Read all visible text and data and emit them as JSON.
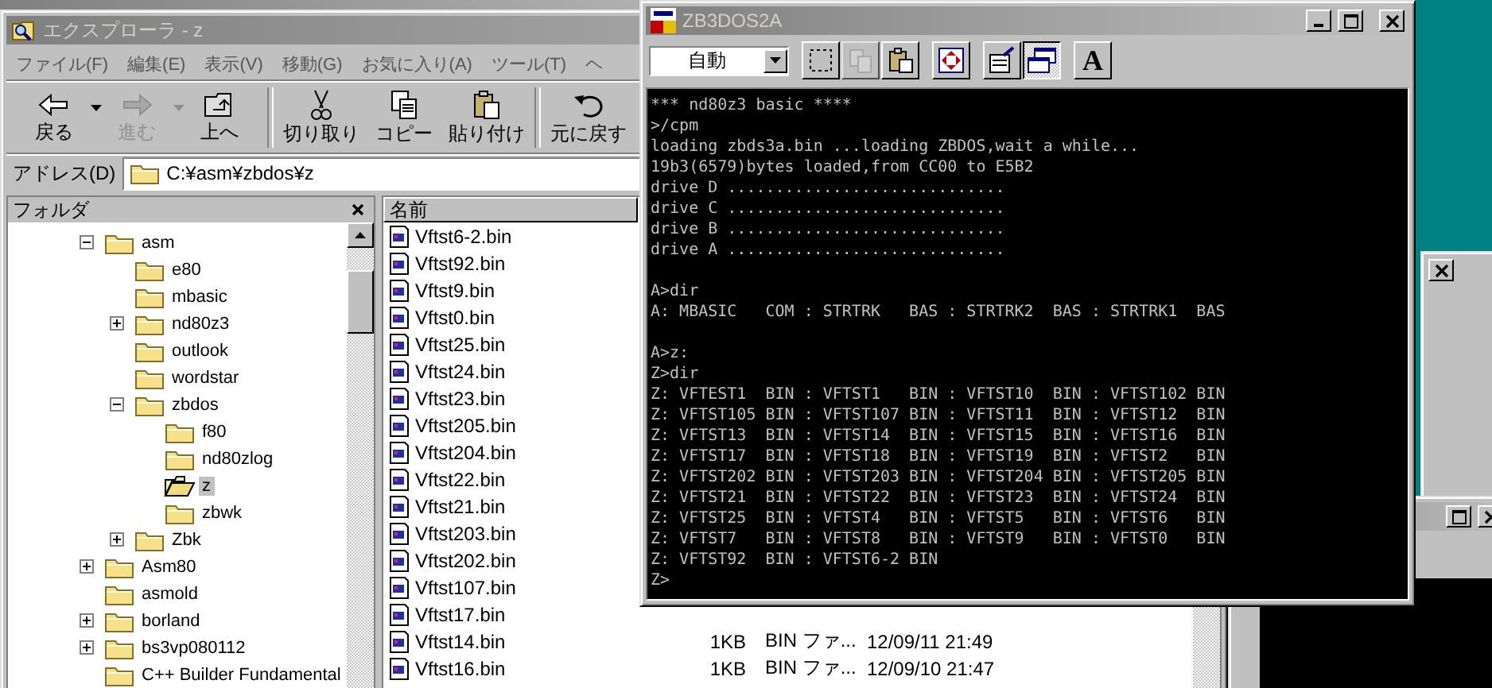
{
  "explorer": {
    "title": "エクスプローラ - z",
    "menu": [
      "ファイル(F)",
      "編集(E)",
      "表示(V)",
      "移動(G)",
      "お気に入り(A)",
      "ツール(T)",
      "ヘ"
    ],
    "toolbar": [
      [
        {
          "kind": "back",
          "label": "戻る",
          "disabled": false,
          "dropdown": true
        },
        {
          "kind": "forward",
          "label": "進む",
          "disabled": true,
          "dropdown": true
        },
        {
          "kind": "up",
          "label": "上へ",
          "disabled": false,
          "dropdown": false
        }
      ],
      [
        {
          "kind": "cut",
          "label": "切り取り",
          "disabled": false,
          "dropdown": false
        },
        {
          "kind": "copy",
          "label": "コピー",
          "disabled": false,
          "dropdown": false
        },
        {
          "kind": "paste",
          "label": "貼り付け",
          "disabled": false,
          "dropdown": false
        }
      ],
      [
        {
          "kind": "undo",
          "label": "元に戻す",
          "disabled": false,
          "dropdown": false
        }
      ]
    ],
    "address": {
      "label": "アドレス(D)",
      "value": "C:¥asm¥zbdos¥z"
    },
    "folders": {
      "title": "フォルダ",
      "items": [
        {
          "name": "asm",
          "expandable": true,
          "expanded": true,
          "selected": false,
          "children": [
            {
              "name": "e80",
              "expandable": false,
              "expanded": false,
              "selected": false
            },
            {
              "name": "mbasic",
              "expandable": false,
              "expanded": false,
              "selected": false
            },
            {
              "name": "nd80z3",
              "expandable": true,
              "expanded": false,
              "selected": false
            },
            {
              "name": "outlook",
              "expandable": false,
              "expanded": false,
              "selected": false
            },
            {
              "name": "wordstar",
              "expandable": false,
              "expanded": false,
              "selected": false
            },
            {
              "name": "zbdos",
              "expandable": true,
              "expanded": true,
              "selected": false,
              "children": [
                {
                  "name": "f80",
                  "expandable": false,
                  "expanded": false,
                  "selected": false
                },
                {
                  "name": "nd80zlog",
                  "expandable": false,
                  "expanded": false,
                  "selected": false
                },
                {
                  "name": "z",
                  "expandable": false,
                  "expanded": false,
                  "selected": true
                },
                {
                  "name": "zbwk",
                  "expandable": false,
                  "expanded": false,
                  "selected": false
                }
              ]
            },
            {
              "name": "Zbk",
              "expandable": true,
              "expanded": false,
              "selected": false
            }
          ]
        },
        {
          "name": "Asm80",
          "expandable": true,
          "expanded": false,
          "selected": false
        },
        {
          "name": "asmold",
          "expandable": false,
          "expanded": false,
          "selected": false
        },
        {
          "name": "borland",
          "expandable": true,
          "expanded": false,
          "selected": false
        },
        {
          "name": "bs3vp080112",
          "expandable": true,
          "expanded": false,
          "selected": false
        },
        {
          "name": "C++ Builder Fundamental",
          "expandable": false,
          "expanded": false,
          "selected": false
        }
      ]
    },
    "files": {
      "columns": [
        "名前"
      ],
      "rows": [
        {
          "name": "Vftst6-2.bin"
        },
        {
          "name": "Vftst92.bin"
        },
        {
          "name": "Vftst9.bin"
        },
        {
          "name": "Vftst0.bin"
        },
        {
          "name": "Vftst25.bin"
        },
        {
          "name": "Vftst24.bin"
        },
        {
          "name": "Vftst23.bin"
        },
        {
          "name": "Vftst205.bin"
        },
        {
          "name": "Vftst204.bin"
        },
        {
          "name": "Vftst22.bin"
        },
        {
          "name": "Vftst21.bin"
        },
        {
          "name": "Vftst203.bin"
        },
        {
          "name": "Vftst202.bin"
        },
        {
          "name": "Vftst107.bin"
        },
        {
          "name": "Vftst17.bin"
        },
        {
          "name": "Vftst14.bin",
          "size": "1KB",
          "type": "BIN ファ...",
          "modified": "12/09/11 21:49"
        },
        {
          "name": "Vftst16.bin",
          "size": "1KB",
          "type": "BIN ファ...",
          "modified": "12/09/10 21:47"
        }
      ]
    }
  },
  "console": {
    "title": "ZB3DOS2A",
    "font_size": "自動",
    "toolbar": [
      [
        {
          "kind": "select",
          "pressed": false,
          "disabled": false
        },
        {
          "kind": "copy",
          "pressed": false,
          "disabled": true
        },
        {
          "kind": "paste",
          "pressed": false,
          "disabled": false
        }
      ],
      [
        {
          "kind": "fullscreen",
          "pressed": false,
          "disabled": false
        }
      ],
      [
        {
          "kind": "properties",
          "pressed": false,
          "disabled": false
        },
        {
          "kind": "background",
          "pressed": true,
          "disabled": false
        }
      ],
      [
        {
          "kind": "font",
          "label": "A",
          "pressed": false,
          "disabled": false
        }
      ]
    ],
    "blocks": [
      [
        "*** nd80z3 basic ****",
        ">/cpm",
        "loading zbds3a.bin ...loading ZBDOS,wait a while...",
        "19b3(6579)bytes loaded,from CC00 to E5B2",
        "drive D .............................",
        "drive C .............................",
        "drive B .............................",
        "drive A ............................."
      ],
      [
        "A>dir",
        "A: MBASIC   COM : STRTRK   BAS : STRTRK2  BAS : STRTRK1  BAS"
      ],
      [
        "A>z:",
        "Z>dir",
        "Z: VFTEST1  BIN : VFTST1   BIN : VFTST10  BIN : VFTST102 BIN",
        "Z: VFTST105 BIN : VFTST107 BIN : VFTST11  BIN : VFTST12  BIN",
        "Z: VFTST13  BIN : VFTST14  BIN : VFTST15  BIN : VFTST16  BIN",
        "Z: VFTST17  BIN : VFTST18  BIN : VFTST19  BIN : VFTST2   BIN",
        "Z: VFTST202 BIN : VFTST203 BIN : VFTST204 BIN : VFTST205 BIN",
        "Z: VFTST21  BIN : VFTST22  BIN : VFTST23  BIN : VFTST24  BIN",
        "Z: VFTST25  BIN : VFTST4   BIN : VFTST5   BIN : VFTST6   BIN",
        "Z: VFTST7   BIN : VFTST8   BIN : VFTST9   BIN : VFTST0   BIN",
        "Z: VFTST92  BIN : VFTST6-2 BIN",
        "Z>"
      ]
    ]
  }
}
